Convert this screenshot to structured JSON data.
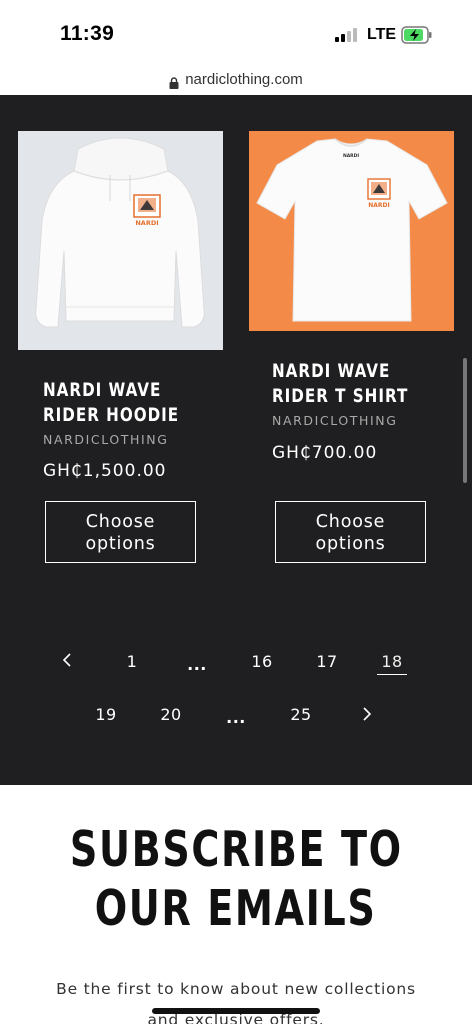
{
  "status_bar": {
    "time": "11:39",
    "network": "LTE",
    "battery_state": "charging"
  },
  "browser": {
    "url": "nardiclothing.com"
  },
  "products": [
    {
      "title_line1": "NARDI WAVE",
      "title_line2": "RIDER HOODIE",
      "vendor": "NARDICLOTHING",
      "price": "GH₵1,500.00",
      "button": "Choose",
      "button_line2": "options",
      "image_bg": "#e2e6ea",
      "garment": "hoodie"
    },
    {
      "title_line1": "NARDI WAVE",
      "title_line2": "RIDER T SHIRT",
      "vendor": "NARDICLOTHING",
      "price": "GH₵700.00",
      "button": "Choose",
      "button_line2": "options",
      "image_bg": "#f38a48",
      "garment": "t-shirt"
    }
  ],
  "logo_text": "NARDI",
  "pagination": {
    "prev_icon": "chevron-left-icon",
    "next_icon": "chevron-right-icon",
    "row1": [
      "1",
      "...",
      "16",
      "17",
      "18"
    ],
    "row2": [
      "19",
      "20",
      "...",
      "25"
    ],
    "current": "18"
  },
  "subscribe": {
    "title_line1": "SUBSCRIBE TO",
    "title_line2": "OUR EMAILS",
    "text_line1": "Be the first to know about new collections",
    "text_line2": "and exclusive offers."
  },
  "colors": {
    "dark_bg": "#1f1f21",
    "accent_orange": "#f38a48"
  }
}
